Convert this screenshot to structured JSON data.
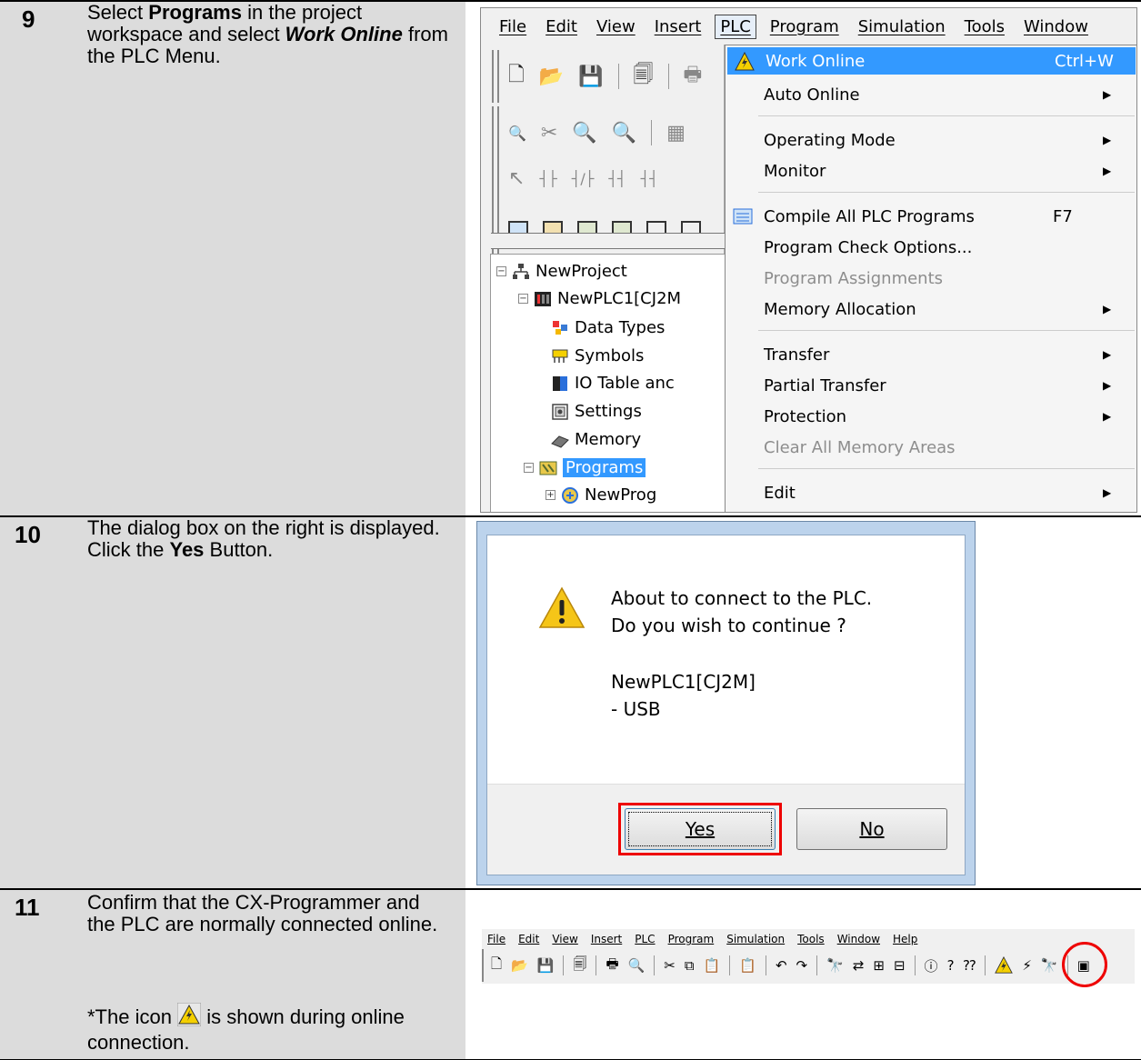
{
  "step9": {
    "number": "9",
    "t1": "Select ",
    "t2": "Programs",
    "t3": " in the project workspace and select ",
    "t4": "Work Online",
    "t5": " from the PLC Menu."
  },
  "step10": {
    "number": "10",
    "t1": "The dialog box on the right is displayed. Click the ",
    "t2": "Yes",
    "t3": " Button."
  },
  "step11": {
    "number": "11",
    "text1": "Confirm that the CX-Programmer and the PLC are normally connected online.",
    "note_prefix": "*The icon",
    "note_suffix": "is shown during online connection."
  },
  "shot1": {
    "menubar": [
      "File",
      "Edit",
      "View",
      "Insert",
      "PLC",
      "Program",
      "Simulation",
      "Tools",
      "Window"
    ],
    "tree": {
      "project": "NewProject",
      "plc": "NewPLC1[CJ2M",
      "data_types": "Data Types",
      "symbols": "Symbols",
      "io_table": "IO Table anc",
      "settings": "Settings",
      "memory": "Memory",
      "programs": "Programs",
      "newprog": "NewProg"
    },
    "plc_menu": {
      "work_online": "Work Online",
      "work_online_shortcut": "Ctrl+W",
      "auto_online": "Auto Online",
      "operating_mode": "Operating Mode",
      "monitor": "Monitor",
      "compile_all": "Compile All PLC Programs",
      "compile_shortcut": "F7",
      "check_options": "Program Check Options...",
      "assignments": "Program Assignments",
      "memory_allocation": "Memory Allocation",
      "transfer": "Transfer",
      "partial_transfer": "Partial Transfer",
      "protection": "Protection",
      "clear_memory": "Clear All Memory Areas",
      "edit": "Edit"
    }
  },
  "dialog": {
    "line1": "About to connect to the PLC.",
    "line2": "Do you wish to continue ?",
    "line3": "NewPLC1[CJ2M]",
    "line4": "- USB",
    "yes": "Yes",
    "no": "No"
  },
  "shot3": {
    "menubar": [
      "File",
      "Edit",
      "View",
      "Insert",
      "PLC",
      "Program",
      "Simulation",
      "Tools",
      "Window",
      "Help"
    ]
  }
}
